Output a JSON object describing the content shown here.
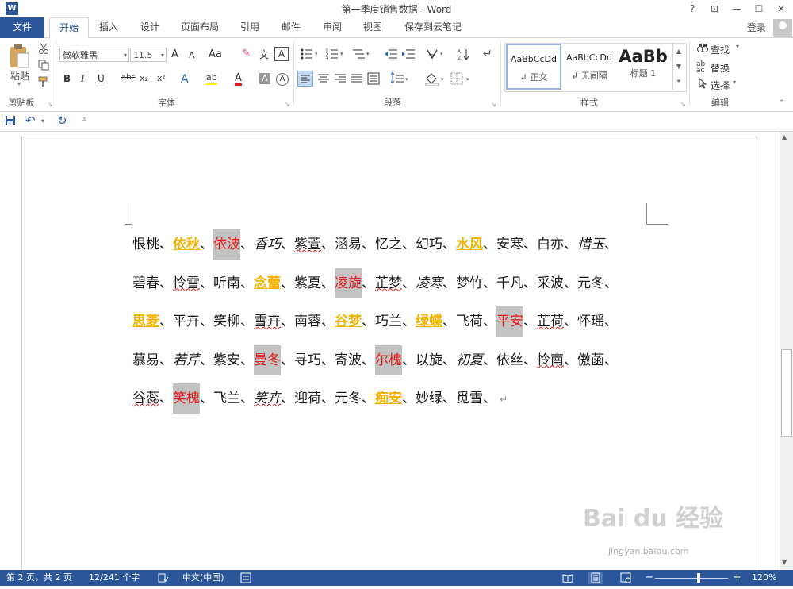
{
  "window": {
    "title": "第一季度销售数据 - Word",
    "help": "?",
    "ribbon_display": "⊡",
    "minimize": "—",
    "maximize": "☐",
    "close": "✕",
    "app_icon": "W"
  },
  "tabs": {
    "file": "文件",
    "items": [
      "开始",
      "插入",
      "设计",
      "页面布局",
      "引用",
      "邮件",
      "审阅",
      "视图",
      "保存到云笔记"
    ],
    "login": "登录"
  },
  "ribbon": {
    "clipboard": {
      "paste": "粘贴",
      "label": "剪贴板"
    },
    "font": {
      "name": "微软雅黑",
      "size": "11.5",
      "grow": "A",
      "shrink": "A",
      "case": "Aa",
      "clear_format": "✎",
      "phonetic": "文",
      "border_char": "A",
      "bold": "B",
      "italic": "I",
      "underline": "U",
      "strike": "abc",
      "subscript": "x₂",
      "superscript": "x²",
      "text_effect": "A",
      "highlight": "ab",
      "font_color": "A",
      "shading": "A",
      "enclose": "A",
      "label": "字体"
    },
    "paragraph": {
      "label": "段落"
    },
    "styles": {
      "items": [
        {
          "preview": "AaBbCcDd",
          "name": "↲ 正文"
        },
        {
          "preview": "AaBbCcDd",
          "name": "↲ 无间隔"
        },
        {
          "preview": "AaBb",
          "name": "标题 1"
        }
      ],
      "label": "样式"
    },
    "editing": {
      "find": "查找",
      "replace": "替换",
      "select": "选择",
      "label": "编辑"
    }
  },
  "document": {
    "lines": [
      [
        {
          "t": "恨桃"
        },
        {
          "t": "、"
        },
        {
          "t": "依秋",
          "c": "y"
        },
        {
          "t": "、"
        },
        {
          "t": "依波",
          "c": "r",
          "hl": true
        },
        {
          "t": "、"
        },
        {
          "t": "香巧",
          "it": true
        },
        {
          "t": "、"
        },
        {
          "t": "紫萱",
          "sp": true
        },
        {
          "t": "、"
        },
        {
          "t": "涵易"
        },
        {
          "t": "、"
        },
        {
          "t": "忆之"
        },
        {
          "t": "、"
        },
        {
          "t": "幻巧"
        },
        {
          "t": "、"
        },
        {
          "t": "水风",
          "c": "y"
        },
        {
          "t": "、"
        },
        {
          "t": "安寒"
        },
        {
          "t": "、"
        },
        {
          "t": "白亦"
        },
        {
          "t": "、"
        },
        {
          "t": "惜玉",
          "it": true
        },
        {
          "t": "、"
        }
      ],
      [
        {
          "t": "碧春"
        },
        {
          "t": "、"
        },
        {
          "t": "怜雪",
          "sp": true
        },
        {
          "t": "、"
        },
        {
          "t": "听南"
        },
        {
          "t": "、"
        },
        {
          "t": "念蕾",
          "c": "y"
        },
        {
          "t": "、"
        },
        {
          "t": "紫夏"
        },
        {
          "t": "、"
        },
        {
          "t": "凌旋",
          "c": "r",
          "hl": true
        },
        {
          "t": "、"
        },
        {
          "t": "芷梦",
          "sp": true
        },
        {
          "t": "、"
        },
        {
          "t": "凌寒",
          "it": true
        },
        {
          "t": "、"
        },
        {
          "t": "梦竹"
        },
        {
          "t": "、"
        },
        {
          "t": "千凡"
        },
        {
          "t": "、"
        },
        {
          "t": "采波"
        },
        {
          "t": "、"
        },
        {
          "t": "元冬"
        },
        {
          "t": "、"
        }
      ],
      [
        {
          "t": "思菱",
          "c": "y"
        },
        {
          "t": "、"
        },
        {
          "t": "平卉"
        },
        {
          "t": "、"
        },
        {
          "t": "笑柳"
        },
        {
          "t": "、"
        },
        {
          "t": "雪卉",
          "sp": true
        },
        {
          "t": "、"
        },
        {
          "t": "南蓉"
        },
        {
          "t": "、"
        },
        {
          "t": "谷梦",
          "c": "y"
        },
        {
          "t": "、"
        },
        {
          "t": "巧兰"
        },
        {
          "t": "、"
        },
        {
          "t": "绿蝶",
          "c": "y"
        },
        {
          "t": "、"
        },
        {
          "t": "飞荷"
        },
        {
          "t": "、"
        },
        {
          "t": "平安",
          "c": "r",
          "hl": true
        },
        {
          "t": "、"
        },
        {
          "t": "芷荷",
          "sp": true
        },
        {
          "t": "、"
        },
        {
          "t": "怀瑶"
        },
        {
          "t": "、"
        }
      ],
      [
        {
          "t": "慕易"
        },
        {
          "t": "、"
        },
        {
          "t": "若芹",
          "it": true
        },
        {
          "t": "、"
        },
        {
          "t": "紫安"
        },
        {
          "t": "、"
        },
        {
          "t": "曼冬",
          "c": "r",
          "hl": true
        },
        {
          "t": "、"
        },
        {
          "t": "寻巧"
        },
        {
          "t": "、"
        },
        {
          "t": "寄波"
        },
        {
          "t": "、"
        },
        {
          "t": "尔槐",
          "c": "r",
          "hl": true
        },
        {
          "t": "、"
        },
        {
          "t": "以旋"
        },
        {
          "t": "、"
        },
        {
          "t": "初夏",
          "it": true
        },
        {
          "t": "、"
        },
        {
          "t": "依丝"
        },
        {
          "t": "、"
        },
        {
          "t": "怜南",
          "sp": true
        },
        {
          "t": "、"
        },
        {
          "t": "傲菡"
        },
        {
          "t": "、"
        }
      ],
      [
        {
          "t": "谷蕊",
          "sp": true
        },
        {
          "t": "、"
        },
        {
          "t": "笑槐",
          "c": "r",
          "hl": true
        },
        {
          "t": "、"
        },
        {
          "t": "飞兰"
        },
        {
          "t": "、"
        },
        {
          "t": "笑卉",
          "it": true,
          "sp": true
        },
        {
          "t": "、"
        },
        {
          "t": "迎荷"
        },
        {
          "t": "、"
        },
        {
          "t": "元冬"
        },
        {
          "t": "、"
        },
        {
          "t": "痴安",
          "c": "y"
        },
        {
          "t": "、"
        },
        {
          "t": "妙绿"
        },
        {
          "t": "、"
        },
        {
          "t": "觅雪"
        },
        {
          "t": "、"
        }
      ]
    ],
    "para_mark": "↵"
  },
  "status": {
    "page": "第 2 页，共 2 页",
    "words": "12/241 个字",
    "lang": "中文(中国)",
    "zoom_minus": "−",
    "zoom_plus": "+",
    "zoom": "120%",
    "zoom_level": 0.6
  },
  "watermark": {
    "text": "Bai du 经验",
    "url": "jingyan.baidu.com"
  },
  "colors": {
    "accent": "#2b579a",
    "yellow_text": "#f3b200",
    "red_text": "#e31b1b",
    "highlight_gray": "#c3c3c3"
  }
}
